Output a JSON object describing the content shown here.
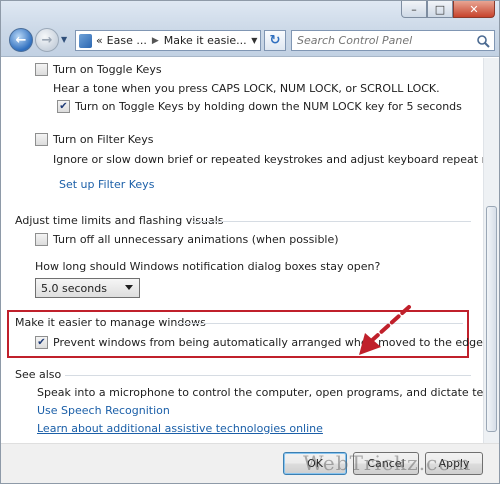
{
  "window": {
    "caption_minimize": "–",
    "caption_maximize": "□",
    "caption_close": "✕"
  },
  "nav": {
    "back_glyph": "←",
    "forward_glyph": "→",
    "breadcrumb_overflow": "«",
    "breadcrumb": [
      "Ease ...",
      "Make it easie..."
    ],
    "refresh_glyph": "↻",
    "search_placeholder": "Search Control Panel"
  },
  "toggle_keys": {
    "label": "Turn on Toggle Keys",
    "checked": false,
    "description": "Hear a tone when you press CAPS LOCK, NUM LOCK, or SCROLL LOCK.",
    "sub_option_label": "Turn on Toggle Keys by holding down the NUM LOCK key for 5 seconds",
    "sub_option_checked": true
  },
  "filter_keys": {
    "label": "Turn on Filter Keys",
    "checked": false,
    "description": "Ignore or slow down brief or repeated keystrokes and adjust keyboard repeat rates.",
    "setup_link": "Set up Filter Keys"
  },
  "time_limits": {
    "heading": "Adjust time limits and flashing visuals",
    "animations_label": "Turn off all unnecessary animations (when possible)",
    "animations_checked": false,
    "notification_question": "How long should Windows notification dialog boxes stay open?",
    "notification_selected": "5.0 seconds"
  },
  "manage_windows": {
    "heading": "Make it easier to manage windows",
    "prevent_label": "Prevent windows from being automatically arranged when moved to the edge of the screen",
    "prevent_checked": true
  },
  "see_also": {
    "heading": "See also",
    "description": "Speak into a microphone to control the computer, open programs, and dictate text.",
    "speech_link": "Use Speech Recognition",
    "assistive_link": "Learn about additional assistive technologies online"
  },
  "footer": {
    "ok_label": "OK",
    "cancel_label": "Cancel",
    "apply_label": "Apply"
  },
  "watermark": "WebTrickz.com",
  "colors": {
    "highlight_box": "#c0202b",
    "arrow": "#c0202b",
    "link": "#1b5fa8"
  }
}
